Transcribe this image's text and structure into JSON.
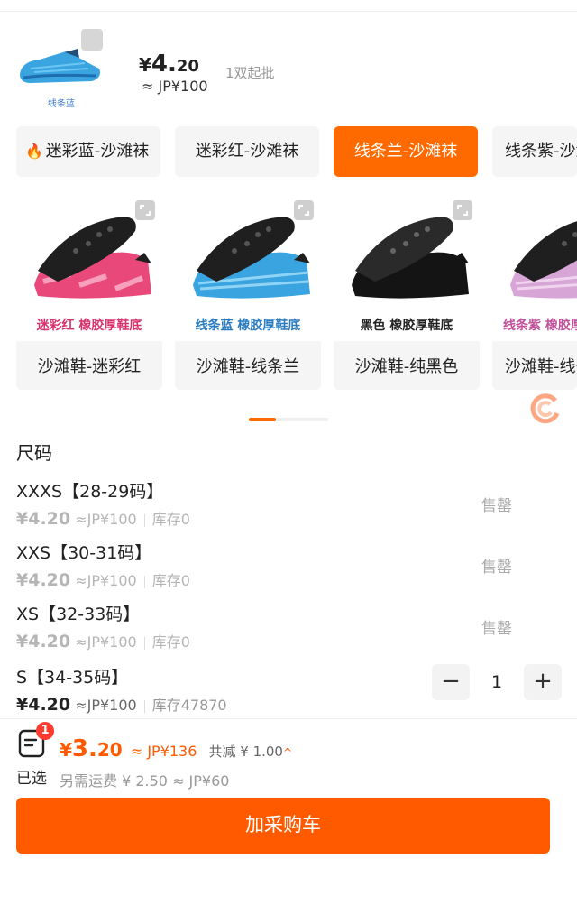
{
  "header": {
    "thumb_label": "线条蓝",
    "price_symbol": "¥",
    "price_int": "4.",
    "price_dec": "20",
    "approx": "≈ JP¥100",
    "moq": "1双起批"
  },
  "color_tabs": [
    {
      "label": "迷彩蓝-沙滩袜",
      "hot": true
    },
    {
      "label": "迷彩红-沙滩袜",
      "hot": false
    },
    {
      "label": "线条兰-沙滩袜",
      "hot": false,
      "active": true
    },
    {
      "label": "线条紫-沙滩袜",
      "hot": false
    }
  ],
  "products": [
    {
      "label": "沙滩鞋-迷彩红",
      "caption": "迷彩红 橡胶厚鞋底",
      "caption_color": "#d6336c"
    },
    {
      "label": "沙滩鞋-线条兰",
      "caption": "线条蓝 橡胶厚鞋底",
      "caption_color": "#2b7bbf"
    },
    {
      "label": "沙滩鞋-纯黑色",
      "caption": "黑色 橡胶厚鞋底",
      "caption_color": "#222222"
    },
    {
      "label": "沙滩鞋-线条紫",
      "caption": "线条紫 橡胶厚鞋底",
      "caption_color": "#c0539a"
    }
  ],
  "size_section": {
    "title": "尺码"
  },
  "sizes": [
    {
      "name": "XXXS【28-29码】",
      "price": "¥4.20",
      "approx": "≈JP¥100",
      "stock": "库存0",
      "status": "售罄"
    },
    {
      "name": "XXS【30-31码】",
      "price": "¥4.20",
      "approx": "≈JP¥100",
      "stock": "库存0",
      "status": "售罄"
    },
    {
      "name": "XS【32-33码】",
      "price": "¥4.20",
      "approx": "≈JP¥100",
      "stock": "库存0",
      "status": "售罄"
    },
    {
      "name": "S【34-35码】",
      "price": "¥4.20",
      "approx": "≈JP¥100",
      "stock": "库存47870",
      "quantity": "1",
      "minus": "−",
      "plus": "+"
    }
  ],
  "footer": {
    "badge": "1",
    "selected_label": "已选",
    "total_symbol": "¥",
    "total_int": "3.",
    "total_dec": "20",
    "total_approx": "≈ JP¥136",
    "discount": "共减 ¥ 1.00",
    "discount_chevron": "^",
    "shipping": "另需运费 ¥ 2.50 ≈ JP¥60"
  },
  "cta_label": "加采购车",
  "colors": {
    "accent": "#ff5a00",
    "badge": "#ff3b30"
  }
}
